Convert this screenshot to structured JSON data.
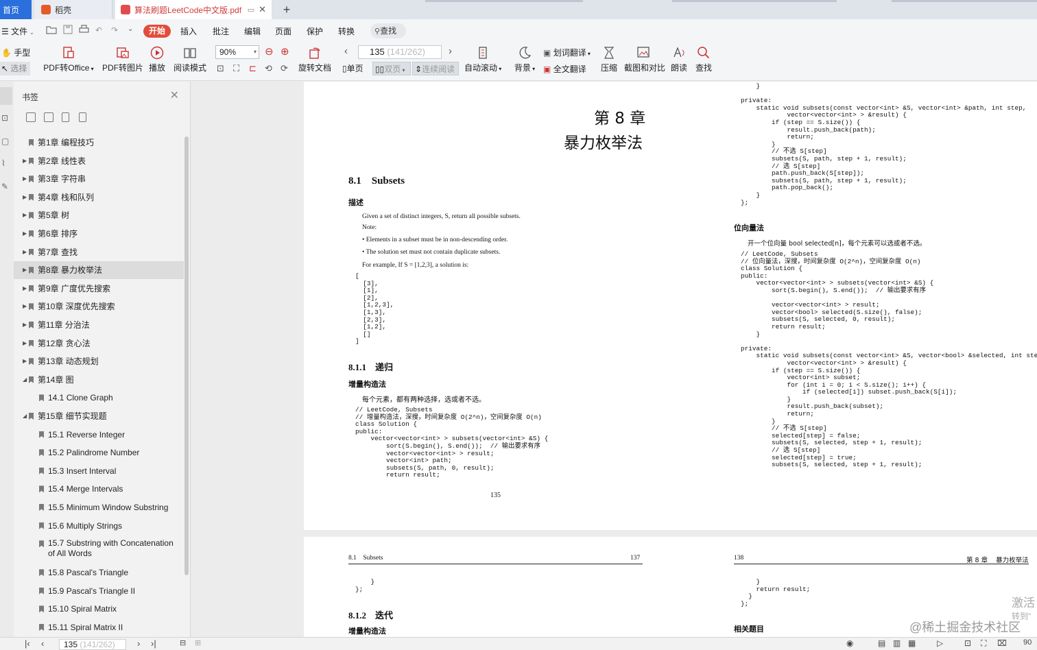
{
  "tabs": {
    "home": "首页",
    "daoke": "稻壳",
    "pdf": "算法刷题LeetCode中文版.pdf"
  },
  "menu": {
    "file": "文件",
    "kaishi": "开始",
    "insert": "插入",
    "annotate": "批注",
    "edit": "编辑",
    "page": "页面",
    "protect": "保护",
    "convert": "转换",
    "search": "查找"
  },
  "toolbar": {
    "hand": "手型",
    "select": "选择",
    "pdf2office": "PDF转Office",
    "pdf2img": "PDF转图片",
    "play": "播放",
    "readmode": "阅读模式",
    "zoom": "90%",
    "rotate": "旋转文档",
    "page_current": "135",
    "page_suffix": "(141/262)",
    "single": "单页",
    "double": "双页",
    "continuous": "连续阅读",
    "autoscroll": "自动滚动",
    "background": "背景",
    "word_translate": "划词翻译",
    "full_translate": "全文翻译",
    "compress": "压缩",
    "screenshot": "截图和对比",
    "read_aloud": "朗读",
    "find": "查找"
  },
  "sidebar": {
    "title": "书签",
    "items": [
      {
        "label": "第1章  编程技巧",
        "level": 1,
        "arrow": ""
      },
      {
        "label": "第2章  线性表",
        "level": 1,
        "arrow": "▶"
      },
      {
        "label": "第3章  字符串",
        "level": 1,
        "arrow": "▶"
      },
      {
        "label": "第4章  栈和队列",
        "level": 1,
        "arrow": "▶"
      },
      {
        "label": "第5章  树",
        "level": 1,
        "arrow": "▶"
      },
      {
        "label": "第6章  排序",
        "level": 1,
        "arrow": "▶"
      },
      {
        "label": "第7章  查找",
        "level": 1,
        "arrow": "▶"
      },
      {
        "label": "第8章  暴力枚举法",
        "level": 1,
        "arrow": "▶",
        "selected": true
      },
      {
        "label": "第9章  广度优先搜索",
        "level": 1,
        "arrow": "▶"
      },
      {
        "label": "第10章  深度优先搜索",
        "level": 1,
        "arrow": "▶"
      },
      {
        "label": "第11章  分治法",
        "level": 1,
        "arrow": "▶"
      },
      {
        "label": "第12章  贪心法",
        "level": 1,
        "arrow": "▶"
      },
      {
        "label": "第13章  动态规划",
        "level": 1,
        "arrow": "▶"
      },
      {
        "label": "第14章  图",
        "level": 1,
        "arrow": "◢"
      },
      {
        "label": "14.1 Clone Graph",
        "level": 2,
        "arrow": ""
      },
      {
        "label": "第15章  细节实现题",
        "level": 1,
        "arrow": "◢"
      },
      {
        "label": "15.1 Reverse Integer",
        "level": 2,
        "arrow": ""
      },
      {
        "label": "15.2 Palindrome Number",
        "level": 2,
        "arrow": ""
      },
      {
        "label": "15.3 Insert Interval",
        "level": 2,
        "arrow": ""
      },
      {
        "label": "15.4 Merge Intervals",
        "level": 2,
        "arrow": ""
      },
      {
        "label": "15.5 Minimum Window Substring",
        "level": 2,
        "arrow": ""
      },
      {
        "label": "15.6 Multiply Strings",
        "level": 2,
        "arrow": ""
      },
      {
        "label": "15.7 Substring with Concatenation of All Words",
        "level": 2,
        "arrow": ""
      },
      {
        "label": "15.8 Pascal's Triangle",
        "level": 2,
        "arrow": ""
      },
      {
        "label": "15.9 Pascal's Triangle II",
        "level": 2,
        "arrow": ""
      },
      {
        "label": "15.10 Spiral Matrix",
        "level": 2,
        "arrow": ""
      },
      {
        "label": "15.11 Spiral Matrix II",
        "level": 2,
        "arrow": ""
      }
    ]
  },
  "page_left": {
    "chapter_num": "第 8 章",
    "chapter_title": "暴力枚举法",
    "section": "8.1    Subsets",
    "desc_heading": "描述",
    "desc_line1": "Given a set of distinct integers, S, return all possible subsets.",
    "desc_note": "Note:",
    "desc_bullet1": "• Elements in a subset must be in non-descending order.",
    "desc_bullet2": "• The solution set must not contain duplicate subsets.",
    "desc_example": "For example, If S = [1,2,3], a solution is:",
    "example_code": "[\n  [3],\n  [1],\n  [2],\n  [1,2,3],\n  [1,3],\n  [2,3],\n  [1,2],\n  []\n]",
    "subsection": "8.1.1    递归",
    "method_heading": "增量构造法",
    "method_text": "每个元素，都有两种选择，选或者不选。",
    "code": "// LeetCode, Subsets\n// 增量构造法，深搜，时间复杂度 O(2^n)，空间复杂度 O(n)\nclass Solution {\npublic:\n    vector<vector<int> > subsets(vector<int> &S) {\n        sort(S.begin(), S.end());  // 输出要求有序\n        vector<vector<int> > result;\n        vector<int> path;\n        subsets(S, path, 0, result);\n        return result;",
    "page_number": "135"
  },
  "page_right": {
    "code1": "    }\n\nprivate:\n    static void subsets(const vector<int> &S, vector<int> &path, int step,\n            vector<vector<int> > &result) {\n        if (step == S.size()) {\n            result.push_back(path);\n            return;\n        }\n        // 不选 S[step]\n        subsets(S, path, step + 1, result);\n        // 选 S[step]\n        path.push_back(S[step]);\n        subsets(S, path, step + 1, result);\n        path.pop_back();\n    }\n};",
    "heading": "位向量法",
    "text": "开一个位向量 bool selected[n]，每个元素可以选或者不选。",
    "code2": "// LeetCode, Subsets\n// 位向量法，深搜，时间复杂度 O(2^n)，空间复杂度 O(n)\nclass Solution {\npublic:\n    vector<vector<int> > subsets(vector<int> &S) {\n        sort(S.begin(), S.end());  // 输出要求有序\n\n        vector<vector<int> > result;\n        vector<bool> selected(S.size(), false);\n        subsets(S, selected, 0, result);\n        return result;\n    }\n\nprivate:\n    static void subsets(const vector<int> &S, vector<bool> &selected, int step,\n            vector<vector<int> > &result) {\n        if (step == S.size()) {\n            vector<int> subset;\n            for (int i = 0; i < S.size(); i++) {\n                if (selected[i]) subset.push_back(S[i]);\n            }\n            result.push_back(subset);\n            return;\n        }\n        // 不选 S[step]\n        selected[step] = false;\n        subsets(S, selected, step + 1, result);\n        // 选 S[step]\n        selected[step] = true;\n        subsets(S, selected, step + 1, result);"
  },
  "page_next_left": {
    "header_section": "8.1    Subsets",
    "header_page": "137",
    "code": "    }\n};",
    "subsection": "8.1.2    迭代",
    "method_heading": "增量构造法"
  },
  "page_next_right": {
    "header_page": "138",
    "header_chapter": "第 8 章    暴力枚举法",
    "code": "    }\n    return result;\n  }\n};",
    "heading": "相关题目"
  },
  "bottom": {
    "page_current": "135",
    "page_suffix": "(141/262)",
    "zoom": "90"
  },
  "overlay": {
    "activate1": "激活",
    "activate2": "转到\"",
    "watermark": "@稀土掘金技术社区"
  }
}
